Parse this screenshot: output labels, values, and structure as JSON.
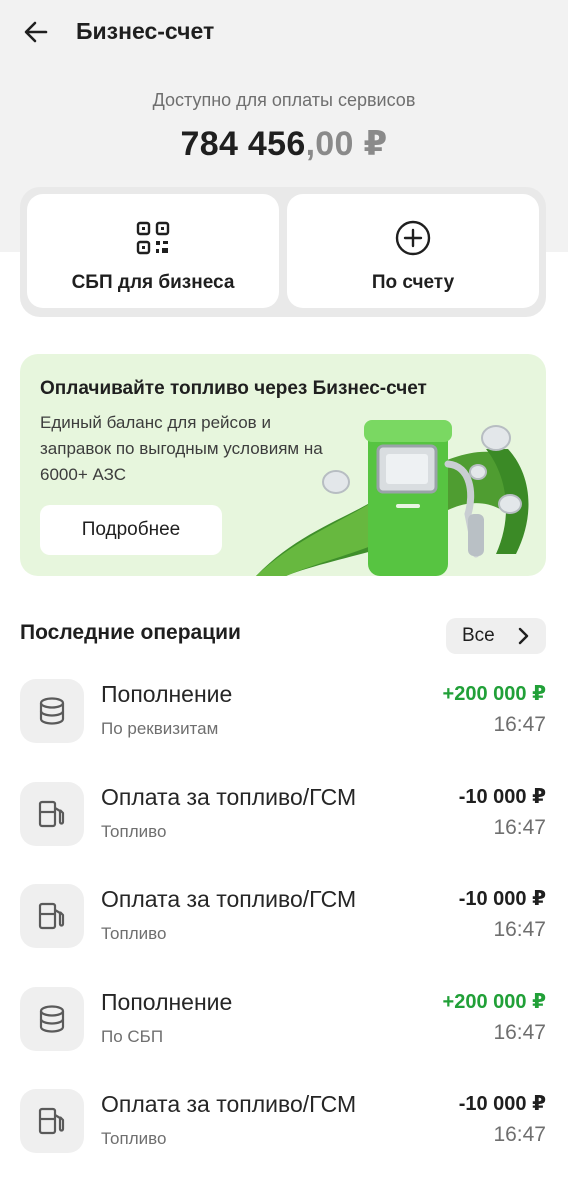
{
  "header": {
    "title": "Бизнес-счет",
    "back_icon": "arrow-left-icon"
  },
  "account": {
    "available_label": "Доступно для оплаты сервисов",
    "balance_int": "784 456",
    "balance_dec": ",00 ₽"
  },
  "actions": [
    {
      "label": "СБП для бизнеса",
      "icon": "qr-code-icon"
    },
    {
      "label": "По счету",
      "icon": "plus-circle-icon"
    }
  ],
  "promo": {
    "title": "Оплачивайте топливо через Бизнес-счет",
    "text": "Единый баланс для рейсов и заправок по выгодным условиям на 6000+ АЗС",
    "button": "Подробнее"
  },
  "operations_section": {
    "title": "Последние операции",
    "all_label": "Все"
  },
  "operations": [
    {
      "name": "Пополнение",
      "sub": "По реквизитам",
      "amount": "+200 000 ₽",
      "time": "16:47",
      "type": "income",
      "icon": "database-icon"
    },
    {
      "name": "Оплата за топливо/ГСМ",
      "sub": "Топливо",
      "amount": "-10 000 ₽",
      "time": "16:47",
      "type": "expense",
      "icon": "fuel-pump-icon"
    },
    {
      "name": "Оплата за топливо/ГСМ",
      "sub": "Топливо",
      "amount": "-10 000 ₽",
      "time": "16:47",
      "type": "expense",
      "icon": "fuel-pump-icon"
    },
    {
      "name": "Пополнение",
      "sub": "По СБП",
      "amount": "+200 000 ₽",
      "time": "16:47",
      "type": "income",
      "icon": "database-icon"
    },
    {
      "name": "Оплата за топливо/ГСМ",
      "sub": "Топливо",
      "amount": "-10 000 ₽",
      "time": "16:47",
      "type": "expense",
      "icon": "fuel-pump-icon"
    }
  ],
  "colors": {
    "positive": "#21a038",
    "promo_bg": "#e7f6dd",
    "accent_green": "#5cc84a"
  }
}
